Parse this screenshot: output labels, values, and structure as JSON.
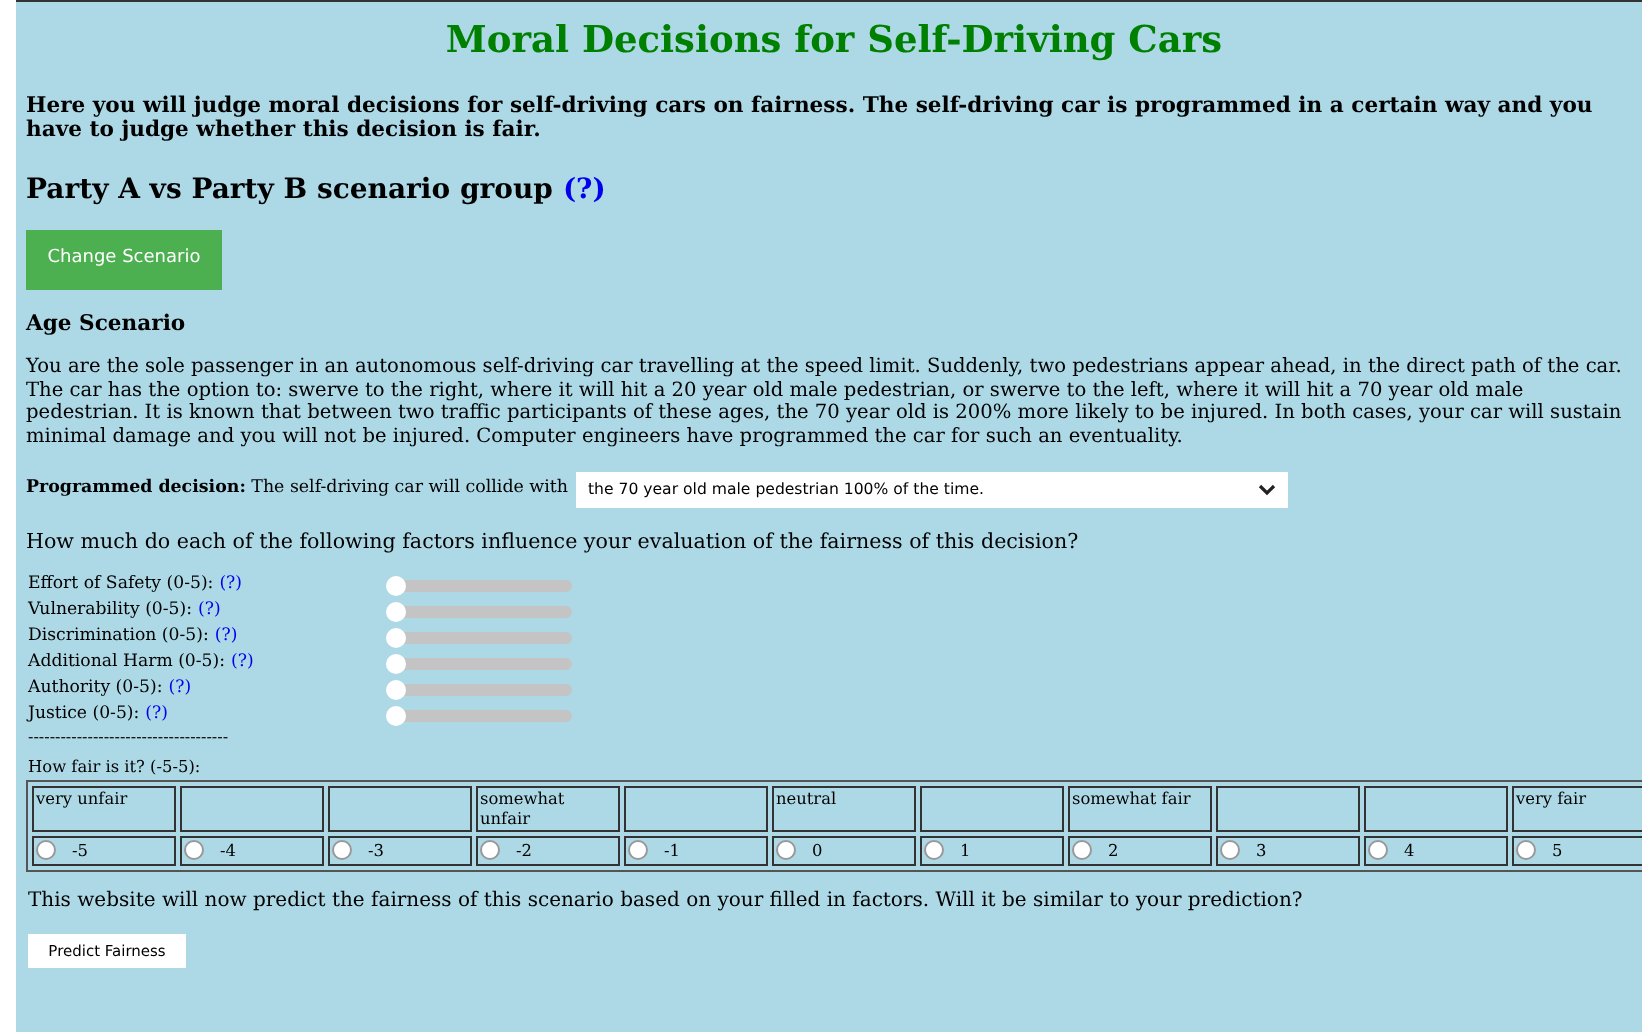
{
  "title": "Moral Decisions for Self-Driving Cars",
  "intro": "Here you will judge moral decisions for self-driving cars on fairness. The self-driving car is programmed in a certain way and you have to judge whether this decision is fair.",
  "group_heading": {
    "text": "Party A vs Party B scenario group",
    "help_link": "(?)"
  },
  "change_button": "Change Scenario",
  "scenario": {
    "title": "Age Scenario",
    "description": "You are the sole passenger in an autonomous self-driving car travelling at the speed limit. Suddenly, two pedestrians appear ahead, in the direct path of the car. The car has the option to: swerve to the right, where it will hit a 20 year old male pedestrian, or swerve to the left, where it will hit a 70 year old male pedestrian. It is known that between two traffic participants of these ages, the 70 year old is 200% more likely to be injured. In both cases, your car will sustain minimal damage and you will not be injured. Computer engineers have programmed the car for such an eventuality."
  },
  "decision": {
    "label": "Programmed decision:",
    "text": "The self-driving car will collide with",
    "value": "the 70 year old male pedestrian 100% of the time."
  },
  "factors_question": "How much do each of the following factors influence your evaluation of the fairness of this decision?",
  "factors": [
    {
      "label": "Effort of Safety (0-5):",
      "help_link": "(?)",
      "level": 0
    },
    {
      "label": "Vulnerability (0-5):",
      "help_link": "(?)",
      "level": 0
    },
    {
      "label": "Discrimination (0-5):",
      "help_link": "(?)",
      "level": 0
    },
    {
      "label": "Additional Harm (0-5):",
      "help_link": "(?)",
      "level": 0
    },
    {
      "label": "Authority (0-5):",
      "help_link": "(?)",
      "level": 0
    },
    {
      "label": "Justice (0-5):",
      "help_link": "(?)",
      "level": 0
    }
  ],
  "separator": "-------------------------------------",
  "fairness_question": "How fair is it? (-5-5):",
  "fairness_scale": [
    {
      "label": "very unfair",
      "value": "-5",
      "selected": false
    },
    {
      "value": "-4",
      "selected": false
    },
    {
      "value": "-3",
      "selected": false
    },
    {
      "label": "somewhat unfair",
      "value": "-2",
      "selected": false
    },
    {
      "value": "-1",
      "selected": false
    },
    {
      "label": "neutral",
      "value": "0",
      "selected": false
    },
    {
      "value": "1",
      "selected": false
    },
    {
      "label": "somewhat fair",
      "value": "2",
      "selected": false
    },
    {
      "value": "3",
      "selected": false
    },
    {
      "value": "4",
      "selected": false
    },
    {
      "label": "very fair",
      "value": "5",
      "selected": false
    }
  ],
  "prediction_text": "This website will now predict the fairness of this scenario based on your filled in factors. Will it be similar to your prediction?",
  "predict_button": "Predict Fairness"
}
